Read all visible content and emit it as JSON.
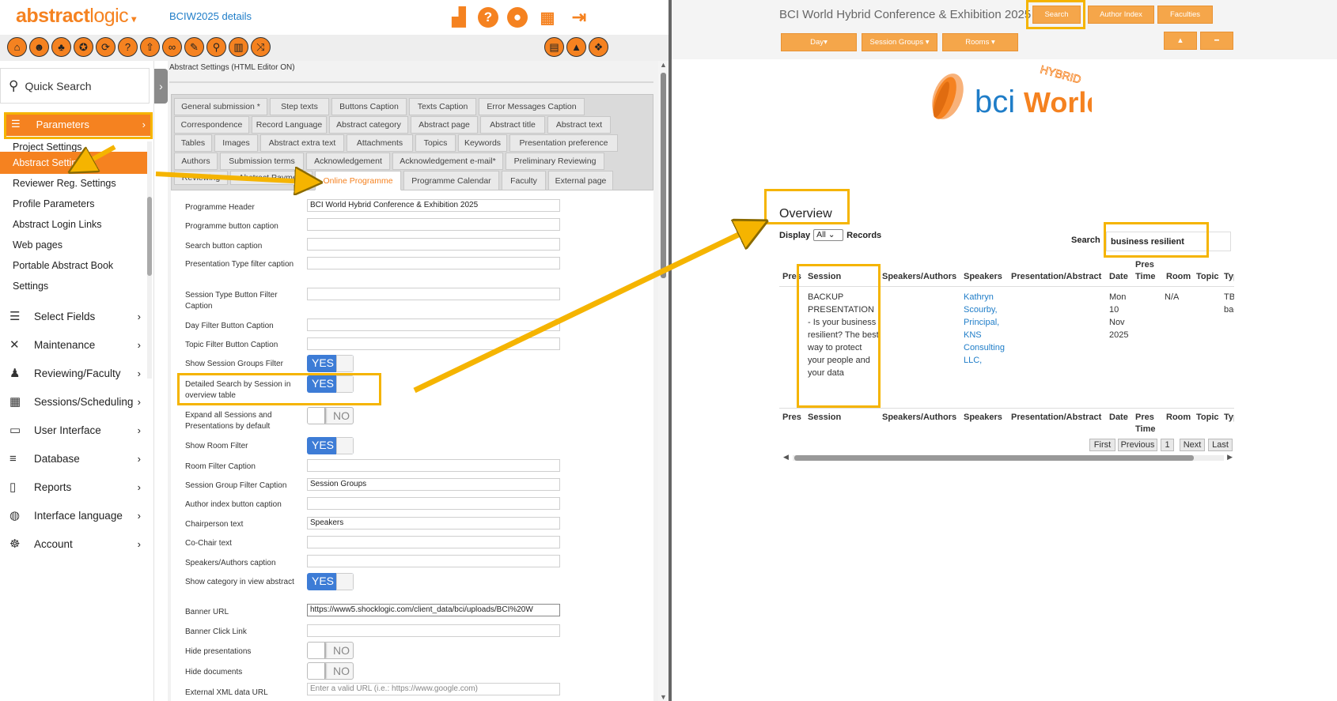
{
  "app": {
    "brand_a": "abstract",
    "brand_b": "logic",
    "project": "BCIW2025 details"
  },
  "sidebar": {
    "quick_search": "Quick Search",
    "parameters": "Parameters",
    "sub_items": [
      "Project Settings",
      "Abstract Settings",
      "Reviewer Reg. Settings",
      "Profile Parameters",
      "Abstract Login Links",
      "Web pages",
      "Portable Abstract Book",
      "Settings"
    ],
    "menu": [
      "Select Fields",
      "Maintenance",
      "Reviewing/Faculty",
      "Sessions/Scheduling",
      "User Interface",
      "Database",
      "Reports",
      "Interface language",
      "Account"
    ]
  },
  "form": {
    "title": "Abstract Settings (HTML Editor ON)",
    "tabs": [
      "General submission *",
      "Step texts",
      "Buttons Caption",
      "Texts Caption",
      "Error Messages Caption",
      "Correspondence",
      "Record Language",
      "Abstract category",
      "Abstract page",
      "Abstract title",
      "Abstract text",
      "Tables",
      "Images",
      "Abstract extra text",
      "Attachments",
      "Topics",
      "Keywords",
      "Presentation preference",
      "Authors",
      "Submission terms",
      "Acknowledgement",
      "Acknowledgement e-mail*",
      "Preliminary Reviewing",
      "Reviewing",
      "Abstract Payment",
      "Online Programme",
      "Programme Calendar",
      "Faculty",
      "External page"
    ],
    "fields": [
      {
        "label": "Programme Header",
        "value": "BCI World Hybrid Conference & Exhibition 2025"
      },
      {
        "label": "Programme button caption",
        "value": ""
      },
      {
        "label": "Search button caption",
        "value": ""
      },
      {
        "label": "Presentation Type filter caption",
        "value": ""
      },
      {
        "label": "Session Type Button Filter Caption",
        "value": ""
      },
      {
        "label": "Day Filter Button Caption",
        "value": ""
      },
      {
        "label": "Topic Filter Button Caption",
        "value": ""
      },
      {
        "label": "Show Session Groups Filter",
        "toggle": "YES"
      },
      {
        "label": "Detailed Search by Session in overview table",
        "toggle": "YES"
      },
      {
        "label": "Expand all Sessions and Presentations by default",
        "toggle": "NO"
      },
      {
        "label": "Show Room Filter",
        "toggle": "YES"
      },
      {
        "label": "Room Filter Caption",
        "value": ""
      },
      {
        "label": "Session Group Filter Caption",
        "value": "Session Groups"
      },
      {
        "label": "Author index button caption",
        "value": ""
      },
      {
        "label": "Chairperson text",
        "value": "Speakers"
      },
      {
        "label": "Co-Chair text",
        "value": ""
      },
      {
        "label": "Speakers/Authors caption",
        "value": ""
      },
      {
        "label": "Show category in view abstract",
        "toggle": "YES"
      },
      {
        "label": "Banner URL",
        "value": "https://www5.shocklogic.com/client_data/bci/uploads/BCI%20W"
      },
      {
        "label": "Banner Click Link",
        "value": ""
      },
      {
        "label": "Hide presentations",
        "toggle": "NO"
      },
      {
        "label": "Hide documents",
        "toggle": "NO"
      },
      {
        "label": "External XML data URL",
        "placeholder": "Enter a valid URL (i.e.: https://www.google.com)"
      }
    ]
  },
  "preview": {
    "title": "BCI World Hybrid Conference & Exhibition 2025",
    "top_buttons": [
      "Search",
      "Author Index",
      "Faculties"
    ],
    "filters": [
      "Day",
      "Session Groups",
      "Rooms"
    ],
    "banner": {
      "bci": "bci",
      "world": "World",
      "hybrid": "HYBRID"
    },
    "overview": "Overview",
    "display": "Display",
    "display_value": "All",
    "records": "Records",
    "search_label": "Search",
    "search_value": "business resilient",
    "columns": [
      "Pres",
      "Session",
      "Speakers/Authors",
      "Speakers",
      "Presentation/Abstract",
      "Date",
      "Pres Time",
      "Room",
      "Topic",
      "Type"
    ],
    "row": {
      "session": "BACKUP PRESENTATION - Is your business resilient? The best way to protect your people and your data",
      "speakers": "Kathryn Scourby, Principal, KNS Consulting LLC,",
      "date": "Mon 10 Nov 2025",
      "room": "N/A",
      "type": "TBC backup"
    },
    "pager": [
      "First",
      "Previous",
      "1",
      "Next",
      "Last"
    ]
  },
  "colors": {
    "accent": "#f58220",
    "highlight": "#f5b400",
    "link": "#1f7dc8",
    "toggle_on": "#3d7cd6"
  }
}
